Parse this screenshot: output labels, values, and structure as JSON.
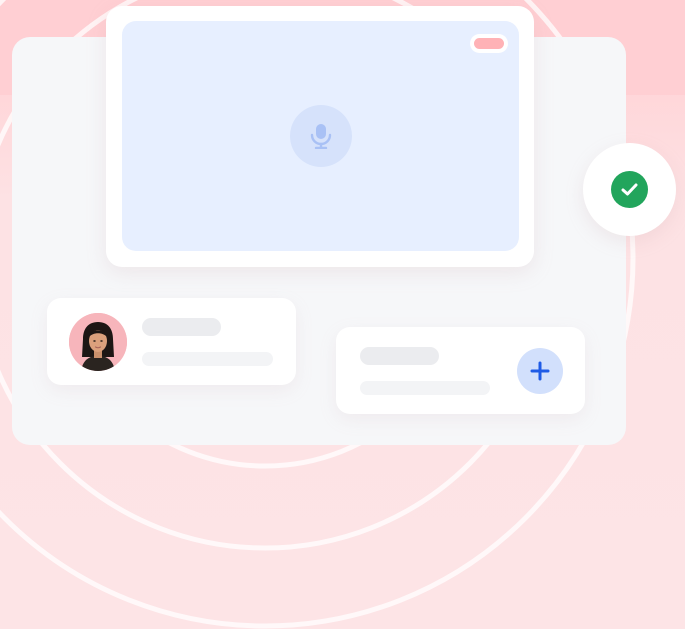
{
  "colors": {
    "background": "#fde3e5",
    "panel": "#f6f7f9",
    "card": "#ffffff",
    "video_screen": "#e7efff",
    "recording_indicator": "#ffb2b6",
    "mic_button": "#d6e2fb",
    "success": "#22a55c",
    "accent_blue": "#1f5be6",
    "skeleton": "#ebecef"
  },
  "icons": {
    "mic": "microphone-icon",
    "check": "checkmark-icon",
    "add": "plus-icon",
    "avatar": "user-avatar"
  }
}
